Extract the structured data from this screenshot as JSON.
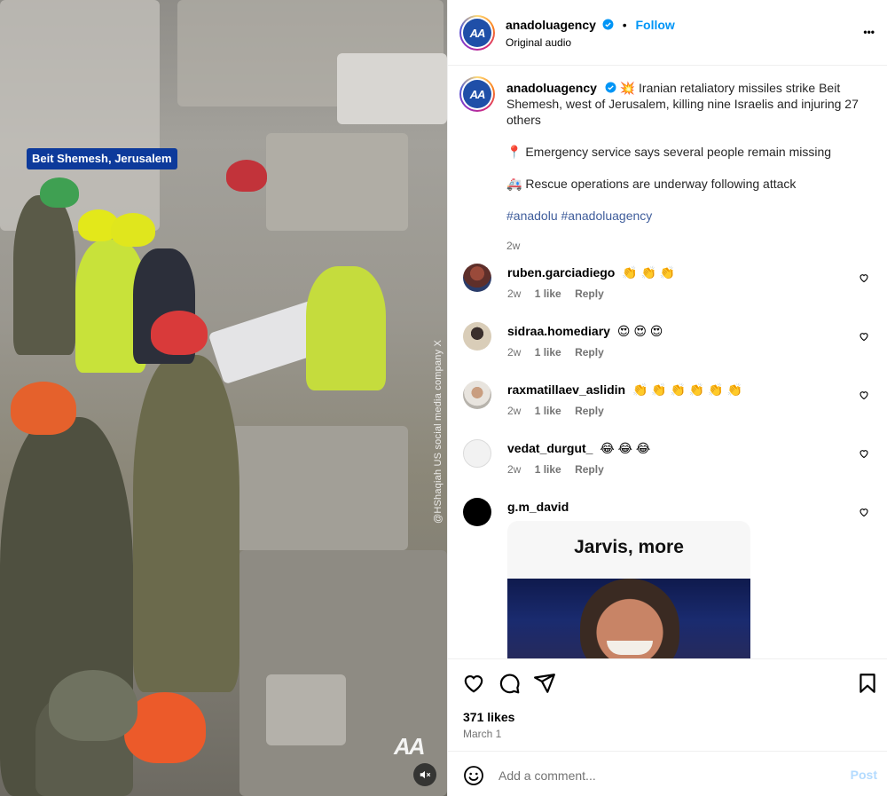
{
  "media": {
    "location_tag": "Beit Shemesh, Jerusalem",
    "credit_watermark": "@HShaqiah US social media company X",
    "brand_watermark": "AA",
    "mute_icon": "speaker-muted-icon"
  },
  "header": {
    "avatar_text": "AA",
    "username": "anadoluagency",
    "separator": "•",
    "follow_label": "Follow",
    "audio": "Original audio",
    "more_label": "•••"
  },
  "caption": {
    "username": "anadoluagency",
    "emoji_burst": "💥",
    "headline": "Iranian retaliatory missiles strike Beit Shemesh, west of Jerusalem, killing nine Israelis and injuring 27 others",
    "pin_emoji": "📍",
    "line2": "Emergency service says several people remain missing",
    "ambulance_emoji": "🚑",
    "line3": "Rescue operations are underway following attack",
    "hashtag1": "#anadolu",
    "hashtag2": "#anadoluagency",
    "time": "2w"
  },
  "comments": [
    {
      "username": "ruben.garciadiego",
      "text": "👏 👏 👏",
      "time": "2w",
      "likes": "1 like",
      "reply": "Reply"
    },
    {
      "username": "sidraa.homediary",
      "text": "😍 😍 😍",
      "time": "2w",
      "likes": "1 like",
      "reply": "Reply"
    },
    {
      "username": "raxmatillaev_aslidin",
      "text": "👏 👏 👏 👏 👏 👏",
      "time": "2w",
      "likes": "1 like",
      "reply": "Reply"
    },
    {
      "username": "vedat_durgut_",
      "text": "😂 😂 😂",
      "time": "2w",
      "likes": "1 like",
      "reply": "Reply"
    },
    {
      "username": "g.m_david",
      "text": "",
      "card_title": "Jarvis, more"
    }
  ],
  "actions": {
    "likes": "371 likes",
    "date": "March 1"
  },
  "composer": {
    "placeholder": "Add a comment...",
    "post_label": "Post"
  },
  "colors": {
    "link_blue": "#0095f6",
    "location_tag_bg": "#0d3a9b",
    "aa_logo_bg": "#1f4fa8"
  }
}
